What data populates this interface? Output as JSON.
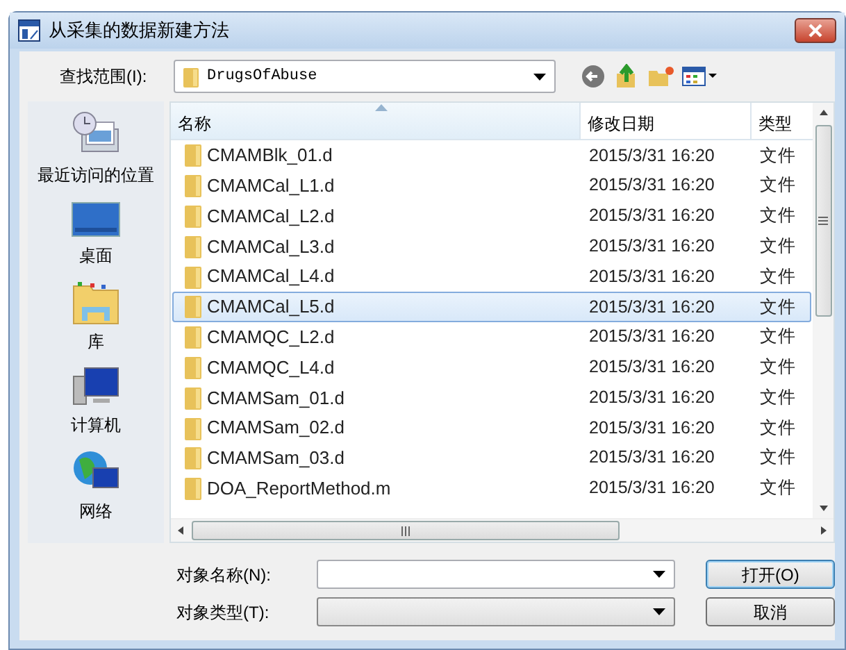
{
  "window": {
    "title": "从采集的数据新建方法"
  },
  "look_in": {
    "label": "查找范围(I):",
    "value": "DrugsOfAbuse"
  },
  "places": [
    {
      "label": "最近访问的位置",
      "kind": "recent"
    },
    {
      "label": "桌面",
      "kind": "desktop"
    },
    {
      "label": "库",
      "kind": "library"
    },
    {
      "label": "计算机",
      "kind": "computer"
    },
    {
      "label": "网络",
      "kind": "network"
    }
  ],
  "table": {
    "columns": [
      {
        "label": "名称",
        "sorted": true
      },
      {
        "label": "修改日期",
        "sorted": false
      },
      {
        "label": "类型",
        "sorted": false
      }
    ],
    "rows": [
      {
        "name": "CMAMBlk_01.d",
        "date": "2015/3/31 16:20",
        "type": "文件",
        "selected": false
      },
      {
        "name": "CMAMCal_L1.d",
        "date": "2015/3/31 16:20",
        "type": "文件",
        "selected": false
      },
      {
        "name": "CMAMCal_L2.d",
        "date": "2015/3/31 16:20",
        "type": "文件",
        "selected": false
      },
      {
        "name": "CMAMCal_L3.d",
        "date": "2015/3/31 16:20",
        "type": "文件",
        "selected": false
      },
      {
        "name": "CMAMCal_L4.d",
        "date": "2015/3/31 16:20",
        "type": "文件",
        "selected": false
      },
      {
        "name": "CMAMCal_L5.d",
        "date": "2015/3/31 16:20",
        "type": "文件",
        "selected": true
      },
      {
        "name": "CMAMQC_L2.d",
        "date": "2015/3/31 16:20",
        "type": "文件",
        "selected": false
      },
      {
        "name": "CMAMQC_L4.d",
        "date": "2015/3/31 16:20",
        "type": "文件",
        "selected": false
      },
      {
        "name": "CMAMSam_01.d",
        "date": "2015/3/31 16:20",
        "type": "文件",
        "selected": false
      },
      {
        "name": "CMAMSam_02.d",
        "date": "2015/3/31 16:20",
        "type": "文件",
        "selected": false
      },
      {
        "name": "CMAMSam_03.d",
        "date": "2015/3/31 16:20",
        "type": "文件",
        "selected": false
      },
      {
        "name": "DOA_ReportMethod.m",
        "date": "2015/3/31 16:20",
        "type": "文件",
        "selected": false
      }
    ]
  },
  "fields": [
    {
      "label": "对象名称(N):",
      "kind": "editable"
    },
    {
      "label": "对象类型(T):",
      "kind": "disabled"
    }
  ],
  "buttons": [
    {
      "label": "打开(O)",
      "default": true
    },
    {
      "label": "取消",
      "default": false
    }
  ]
}
